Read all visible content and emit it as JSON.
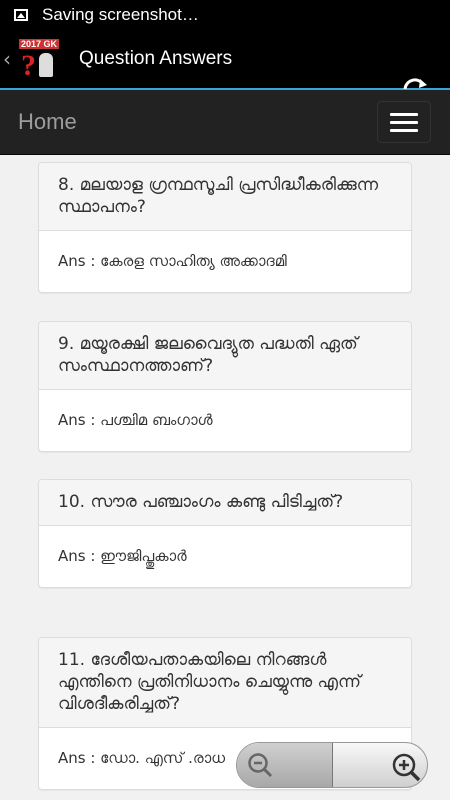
{
  "status_bar": {
    "text": "Saving screenshot…"
  },
  "app_bar": {
    "logo_text": "2017 GK",
    "title": "Question Answers"
  },
  "nav": {
    "home_label": "Home"
  },
  "cards": [
    {
      "question": "8. മലയാള ഗ്രന്ഥസൂചി പ്രസിദ്ധീകരിക്കുന്ന സ്ഥാപനം?",
      "answer": "Ans : കേരള സാഹിത്യ അക്കാദമി"
    },
    {
      "question": "9. മയൂരക്ഷി ജലവൈദ്യുത പദ്ധതി ഏത് സംസ്ഥാനത്താണ്?",
      "answer": "Ans : പശ്ചിമ ബംഗാൾ"
    },
    {
      "question": "10. സൗര പഞ്ചാംഗം കണ്ടു പിടിച്ചത്?",
      "answer": "Ans : ഈജിപ്തുകാർ"
    },
    {
      "question": "11. ദേശീയപതാകയിലെ നിറങ്ങൾ എന്തിനെ പ്രതിനിധാനം ചെയ്യുന്നു എന്ന് വിശദീകരിച്ചത്?",
      "answer": "Ans : ഡോ. എസ് .രാധ"
    }
  ],
  "icons": {
    "status": "image-icon",
    "back": "chevron-left-icon",
    "refresh": "refresh-icon",
    "menu": "hamburger-menu-icon",
    "zoom_out": "zoom-out-icon",
    "zoom_in": "zoom-in-icon"
  },
  "colors": {
    "accent": "#35a8d9",
    "navbar": "#222222",
    "background": "#f1f1f1"
  }
}
